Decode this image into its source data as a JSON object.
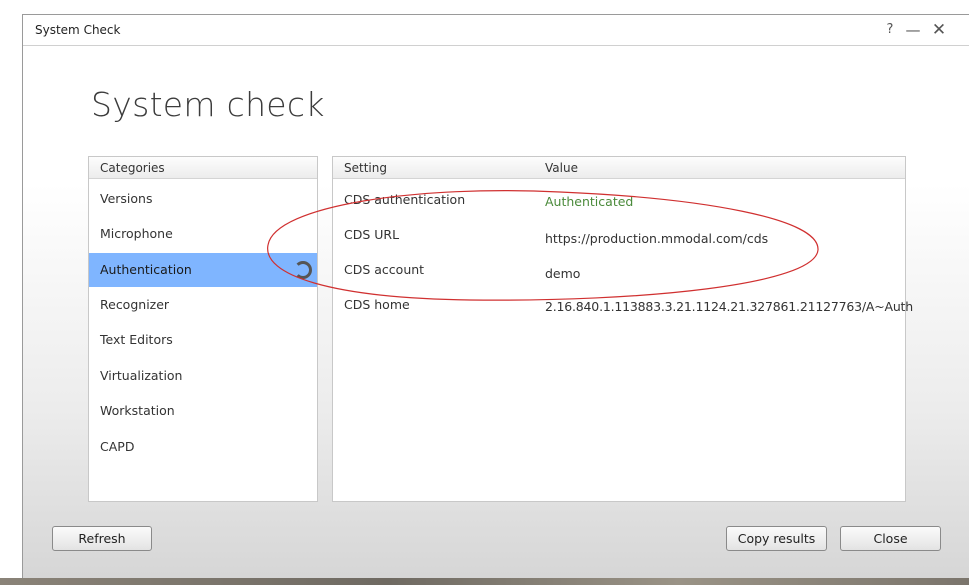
{
  "window": {
    "title": "System Check",
    "help_label": "?",
    "minimize_label": "—",
    "close_label": "✕"
  },
  "page": {
    "title": "System check"
  },
  "categories": {
    "header": "Categories",
    "items": [
      {
        "label": "Versions"
      },
      {
        "label": "Microphone"
      },
      {
        "label": "Authentication"
      },
      {
        "label": "Recognizer"
      },
      {
        "label": "Text Editors"
      },
      {
        "label": "Virtualization"
      },
      {
        "label": "Workstation"
      },
      {
        "label": "CAPD"
      }
    ],
    "selected": "Authentication"
  },
  "settings": {
    "header_setting": "Setting",
    "header_value": "Value",
    "rows": [
      {
        "setting": "CDS authentication",
        "value": "Authenticated"
      },
      {
        "setting": "CDS URL",
        "value": "https://production.mmodal.com/cds"
      },
      {
        "setting": "CDS account",
        "value": "demo"
      },
      {
        "setting": "CDS home",
        "value": "2.16.840.1.113883.3.21.1124.21.327861.21127763/A~Auth"
      }
    ]
  },
  "buttons": {
    "refresh": "Refresh",
    "copy_results": "Copy results",
    "close": "Close"
  },
  "colors": {
    "selection": "#7fb5ff",
    "authenticated": "#4a8a3a",
    "annotation": "#d03030"
  }
}
